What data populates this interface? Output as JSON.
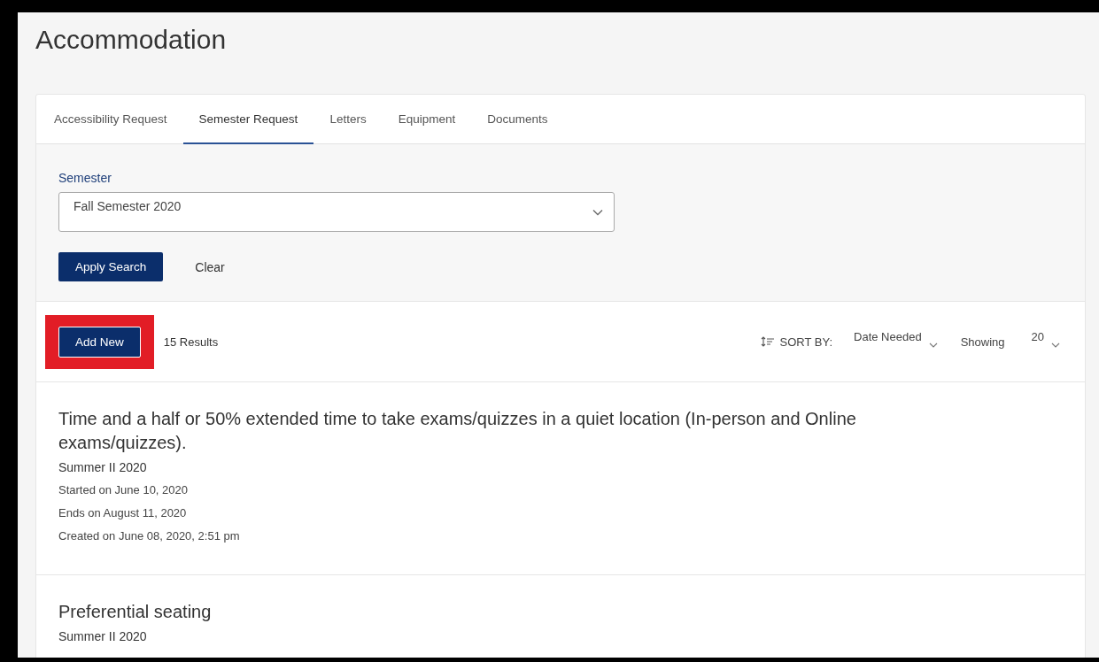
{
  "page": {
    "title": "Accommodation"
  },
  "tabs": [
    {
      "label": "Accessibility Request",
      "selected": false
    },
    {
      "label": "Semester Request",
      "selected": true
    },
    {
      "label": "Letters",
      "selected": false
    },
    {
      "label": "Equipment",
      "selected": false
    },
    {
      "label": "Documents",
      "selected": false
    }
  ],
  "filter": {
    "label": "Semester",
    "value": "Fall Semester 2020",
    "apply_button": "Apply Search",
    "clear_button": "Clear"
  },
  "results_bar": {
    "add_button": {
      "label": "Add New",
      "highlighted": true
    },
    "count": "15 Results",
    "sort_label": "SORT BY:",
    "sort_value": "Date Needed",
    "showing_label": "Showing",
    "showing_value": "20"
  },
  "requests": [
    {
      "title": "Time and a half or 50% extended time to take exams/quizzes in a quiet location (In-person and Online exams/quizzes).",
      "semester": "Summer II 2020",
      "details": [
        "Started on June 10, 2020",
        "Ends on August 11, 2020",
        "Created on June 08, 2020, 2:51 pm"
      ]
    },
    {
      "title": "Preferential seating",
      "semester": "Summer II 2020"
    }
  ]
}
